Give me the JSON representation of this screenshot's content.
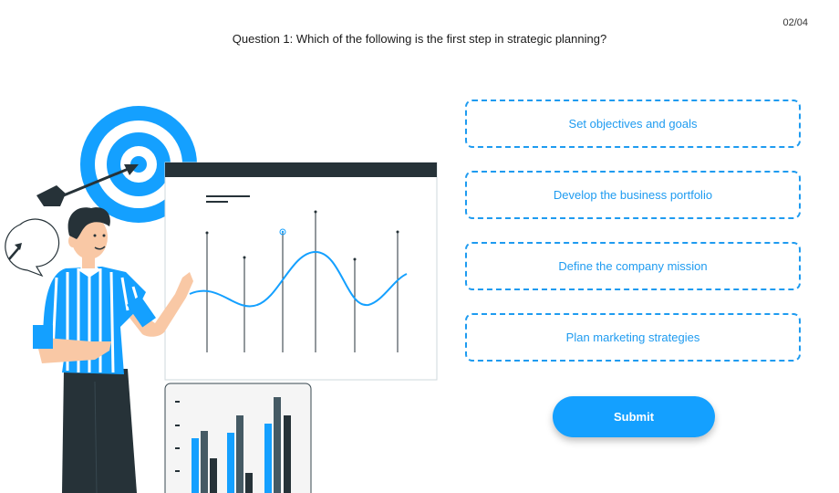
{
  "header": {
    "progress": "02/04",
    "question": "Question 1: Which of the following is the first step in strategic planning?"
  },
  "options": [
    "Set objectives and goals",
    "Develop the business portfolio",
    "Define the company mission",
    "Plan marketing strategies"
  ],
  "submit_label": "Submit",
  "colors": {
    "accent": "#14a0ff",
    "dark": "#263238",
    "skin": "#f9c8a5"
  }
}
